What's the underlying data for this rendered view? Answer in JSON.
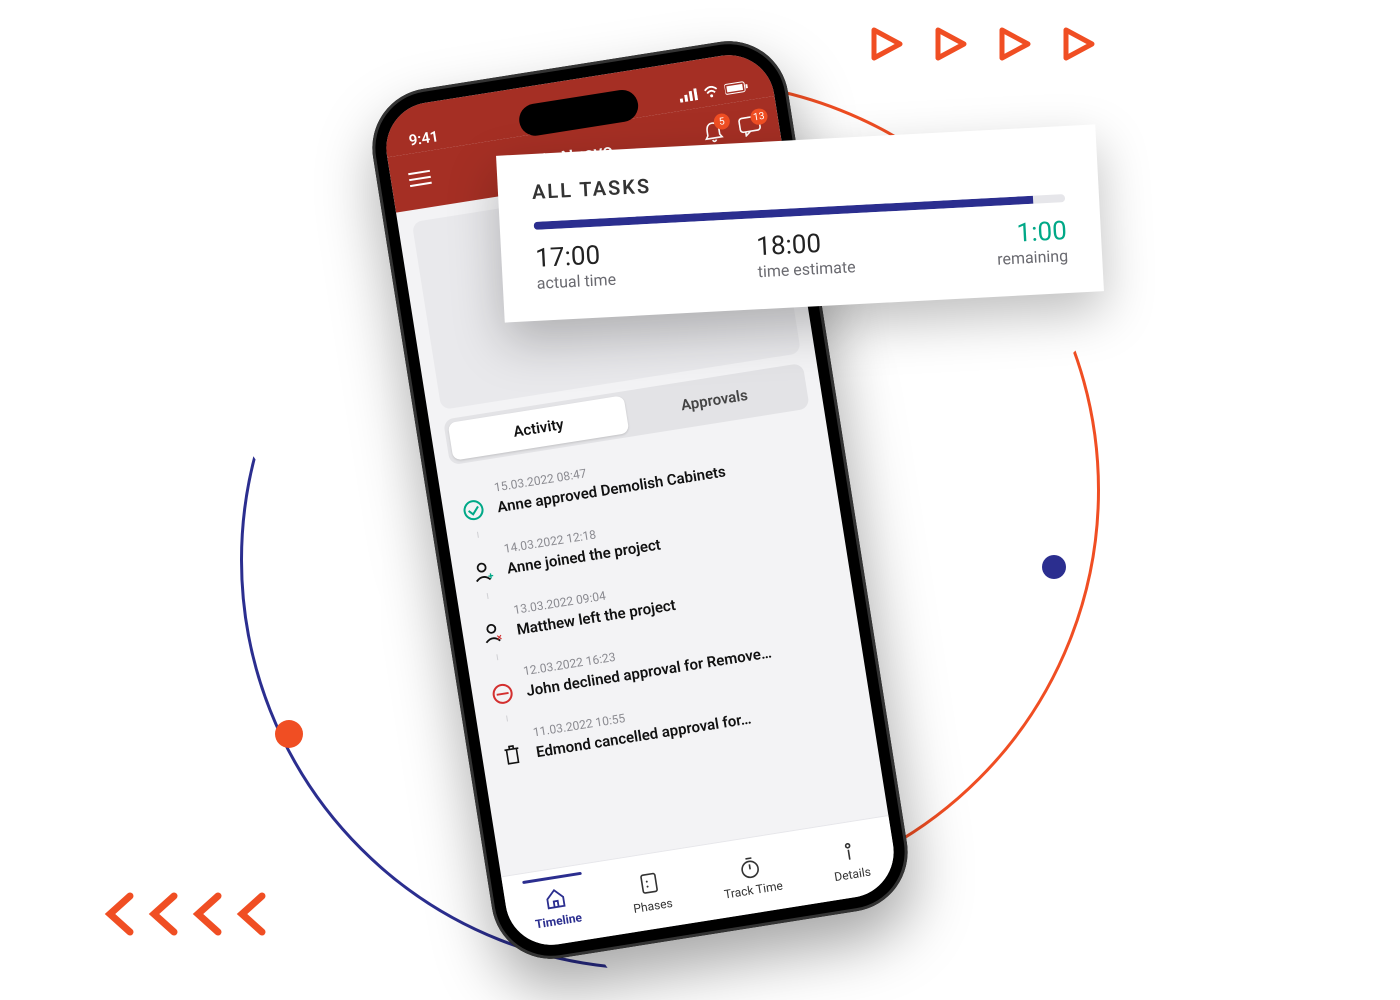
{
  "colors": {
    "accent_red": "#a52f24",
    "brand_orange": "#f04e23",
    "brand_navy": "#2b2e8f",
    "success": "#00a887"
  },
  "status": {
    "time": "9:41"
  },
  "appbar": {
    "title": "Villa Nuovo",
    "bell_badge": "5",
    "chat_badge": "13"
  },
  "tasks_card": {
    "heading": "ALL TASKS",
    "progress_pct": 94,
    "actual_value": "17:00",
    "actual_label": "actual time",
    "estimate_value": "18:00",
    "estimate_label": "time estimate",
    "remaining_value": "1:00",
    "remaining_label": "remaining"
  },
  "segments": {
    "activity": "Activity",
    "approvals": "Approvals"
  },
  "feed": [
    {
      "ts": "15.03.2022  08:47",
      "msg": "Anne approved Demolish Cabinets",
      "icon": "check"
    },
    {
      "ts": "14.03.2022  12:18",
      "msg": "Anne joined the project",
      "icon": "user-plus"
    },
    {
      "ts": "13.03.2022  09:04",
      "msg": "Matthew left the project",
      "icon": "user-minus"
    },
    {
      "ts": "12.03.2022  16:23",
      "msg": "John declined approval for Remove…",
      "icon": "denied"
    },
    {
      "ts": "11.03.2022  10:55",
      "msg": "Edmond cancelled approval for…",
      "icon": "trash"
    }
  ],
  "bottomnav": {
    "timeline": "Timeline",
    "phases": "Phases",
    "track": "Track Time",
    "details": "Details"
  }
}
